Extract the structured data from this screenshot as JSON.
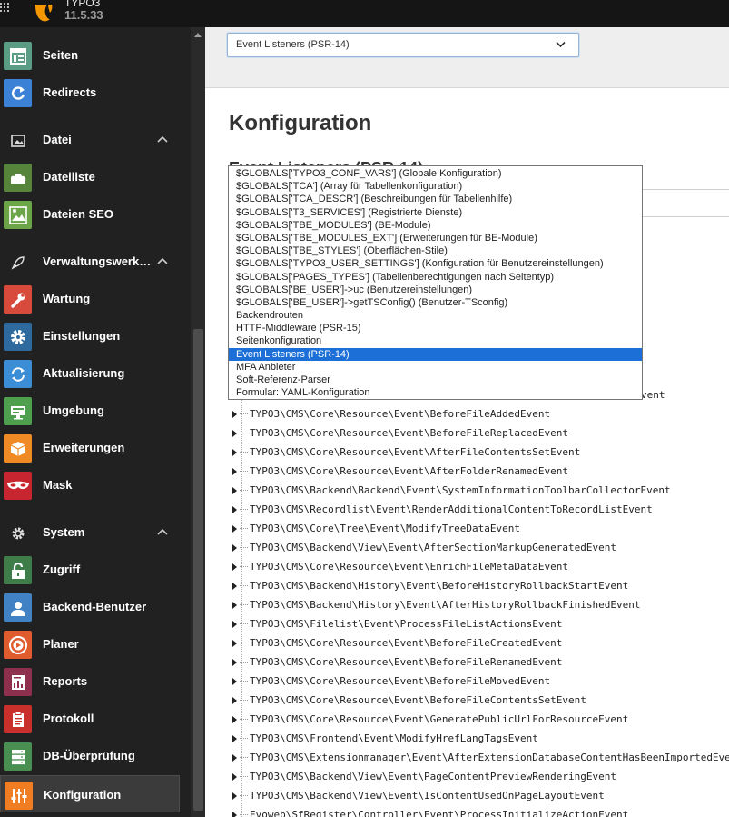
{
  "app": {
    "name": "TYPO3",
    "version": "11.5.33"
  },
  "colors": {
    "topbar": "#151515",
    "sidebar": "#212121",
    "selected_option": "#1c6fd6"
  },
  "sidebar": {
    "items": [
      {
        "label": "Seiten",
        "icon": "page-tree-icon",
        "color": "#5b9d84"
      },
      {
        "label": "Redirects",
        "icon": "redirect-icon",
        "color": "#3b82d6"
      },
      {
        "label": "Datei",
        "icon": "image-group-icon",
        "group": true
      },
      {
        "label": "Dateiliste",
        "icon": "filelist-icon",
        "color": "#56843a"
      },
      {
        "label": "Dateien SEO",
        "icon": "file-seo-icon",
        "color": "#6ba548"
      },
      {
        "label": "Verwaltungswerk…",
        "icon": "rocket-icon",
        "group": true
      },
      {
        "label": "Wartung",
        "icon": "wrench-icon",
        "color": "#d84a3b"
      },
      {
        "label": "Einstellungen",
        "icon": "gear-icon",
        "color": "#2f6a9f"
      },
      {
        "label": "Aktualisierung",
        "icon": "refresh-icon",
        "color": "#3b8dd6"
      },
      {
        "label": "Umgebung",
        "icon": "environment-icon",
        "color": "#4ea04e"
      },
      {
        "label": "Erweiterungen",
        "icon": "package-icon",
        "color": "#f08a24"
      },
      {
        "label": "Mask",
        "icon": "mask-icon",
        "color": "#c7252f"
      },
      {
        "label": "System",
        "icon": "system-gear-icon",
        "group": true
      },
      {
        "label": "Zugriff",
        "icon": "lock-icon",
        "color": "#3e7d4a"
      },
      {
        "label": "Backend-Benutzer",
        "icon": "user-icon",
        "color": "#4182c4"
      },
      {
        "label": "Planer",
        "icon": "scheduler-icon",
        "color": "#e05b2d"
      },
      {
        "label": "Reports",
        "icon": "reports-icon",
        "color": "#8d2f4d"
      },
      {
        "label": "Protokoll",
        "icon": "log-icon",
        "color": "#c9302c"
      },
      {
        "label": "DB-Überprüfung",
        "icon": "database-icon",
        "color": "#4a8f52"
      },
      {
        "label": "Konfiguration",
        "icon": "configuration-icon",
        "color": "#f07d22",
        "active": true
      }
    ]
  },
  "select": {
    "value": "Event Listeners (PSR-14)"
  },
  "main": {
    "title": "Konfiguration",
    "section_title": "Event Listeners (PSR-14)"
  },
  "dropdown": {
    "options": [
      "$GLOBALS['TYPO3_CONF_VARS'] (Globale Konfiguration)",
      "$GLOBALS['TCA'] (Array für Tabellenkonfiguration)",
      "$GLOBALS['TCA_DESCR'] (Beschreibungen für Tabellenhilfe)",
      "$GLOBALS['T3_SERVICES'] (Registrierte Dienste)",
      "$GLOBALS['TBE_MODULES'] (BE-Module)",
      "$GLOBALS['TBE_MODULES_EXT'] (Erweiterungen für BE-Module)",
      "$GLOBALS['TBE_STYLES'] (Oberflächen-Stile)",
      "$GLOBALS['TYPO3_USER_SETTINGS'] (Konfiguration für Benutzereinstellungen)",
      "$GLOBALS['PAGES_TYPES'] (Tabellenberechtigungen nach Seitentyp)",
      "$GLOBALS['BE_USER']->uc (Benutzereinstellungen)",
      "$GLOBALS['BE_USER']->getTSConfig() (Benutzer-TSconfig)",
      "Backendrouten",
      "HTTP-Middleware (PSR-15)",
      "Seitenkonfiguration",
      "Event Listeners (PSR-14)",
      "MFA Anbieter",
      "Soft-Referenz-Parser",
      "Formular: YAML-Konfiguration"
    ],
    "selected_index": 14
  },
  "tree": {
    "partial_row": "vent",
    "rows": [
      "TYPO3\\CMS\\Core\\Resource\\Event\\BeforeFileAddedEvent",
      "TYPO3\\CMS\\Core\\Resource\\Event\\BeforeFileReplacedEvent",
      "TYPO3\\CMS\\Core\\Resource\\Event\\AfterFileContentsSetEvent",
      "TYPO3\\CMS\\Core\\Resource\\Event\\AfterFolderRenamedEvent",
      "TYPO3\\CMS\\Backend\\Backend\\Event\\SystemInformationToolbarCollectorEvent",
      "TYPO3\\CMS\\Recordlist\\Event\\RenderAdditionalContentToRecordListEvent",
      "TYPO3\\CMS\\Core\\Tree\\Event\\ModifyTreeDataEvent",
      "TYPO3\\CMS\\Backend\\View\\Event\\AfterSectionMarkupGeneratedEvent",
      "TYPO3\\CMS\\Core\\Resource\\Event\\EnrichFileMetaDataEvent",
      "TYPO3\\CMS\\Backend\\History\\Event\\BeforeHistoryRollbackStartEvent",
      "TYPO3\\CMS\\Backend\\History\\Event\\AfterHistoryRollbackFinishedEvent",
      "TYPO3\\CMS\\Filelist\\Event\\ProcessFileListActionsEvent",
      "TYPO3\\CMS\\Core\\Resource\\Event\\BeforeFileCreatedEvent",
      "TYPO3\\CMS\\Core\\Resource\\Event\\BeforeFileRenamedEvent",
      "TYPO3\\CMS\\Core\\Resource\\Event\\BeforeFileMovedEvent",
      "TYPO3\\CMS\\Core\\Resource\\Event\\BeforeFileContentsSetEvent",
      "TYPO3\\CMS\\Core\\Resource\\Event\\GeneratePublicUrlForResourceEvent",
      "TYPO3\\CMS\\Frontend\\Event\\ModifyHrefLangTagsEvent",
      "TYPO3\\CMS\\Extensionmanager\\Event\\AfterExtensionDatabaseContentHasBeenImportedEve",
      "TYPO3\\CMS\\Backend\\View\\Event\\PageContentPreviewRenderingEvent",
      "TYPO3\\CMS\\Backend\\View\\Event\\IsContentUsedOnPageLayoutEvent",
      "Evoweb\\SfRegister\\Controller\\Event\\ProcessInitializeActionEvent"
    ]
  }
}
